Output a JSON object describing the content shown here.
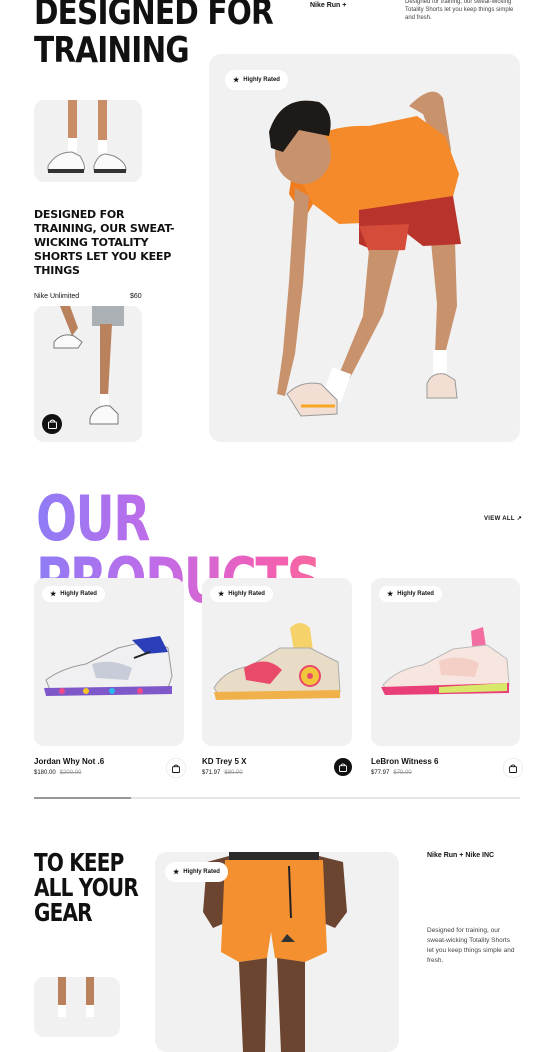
{
  "hero": {
    "title": "DESIGNED FOR TRAINING",
    "top_label": "Nike Run +",
    "top_desc": "Designed for training, our sweat-wicking Totality Shorts let you keep things simple and fresh.",
    "badge": "Highly Rated",
    "side_desc": "DESIGNED FOR TRAINING, OUR SWEAT-WICKING TOTALITY SHORTS LET YOU KEEP THINGS",
    "product_name": "Nike Unlimited",
    "product_price": "$60"
  },
  "products": {
    "title": "OUR PRODUCTS",
    "view_all": "VIEW ALL ↗",
    "items": [
      {
        "badge": "Highly Rated",
        "name": "Jordan Why Not .6",
        "price": "$180.00",
        "old_price": "$200.00",
        "bag": "light"
      },
      {
        "badge": "Highly Rated",
        "name": "KD Trey 5 X",
        "price": "$71.97",
        "old_price": "$80.00",
        "bag": "dark"
      },
      {
        "badge": "Highly Rated",
        "name": "LeBron Witness 6",
        "price": "$77.97",
        "old_price": "$79.00",
        "bag": "light"
      }
    ],
    "scroll_progress": 0.2
  },
  "gear": {
    "title": "TO KEEP ALL YOUR GEAR",
    "badge": "Highly Rated",
    "label": "Nike Run + Nike INC",
    "desc": "Designed for training, our sweat-wicking Totality Shorts let you keep things simple and fresh."
  },
  "colors": {
    "shirt": "#f58a2b",
    "shorts": "#b8332c",
    "gear_shorts": "#f4902f",
    "card_bg": "#f1f1f1"
  },
  "icons": [
    "star-icon",
    "shopping-bag-icon",
    "arrow-up-right-icon"
  ]
}
